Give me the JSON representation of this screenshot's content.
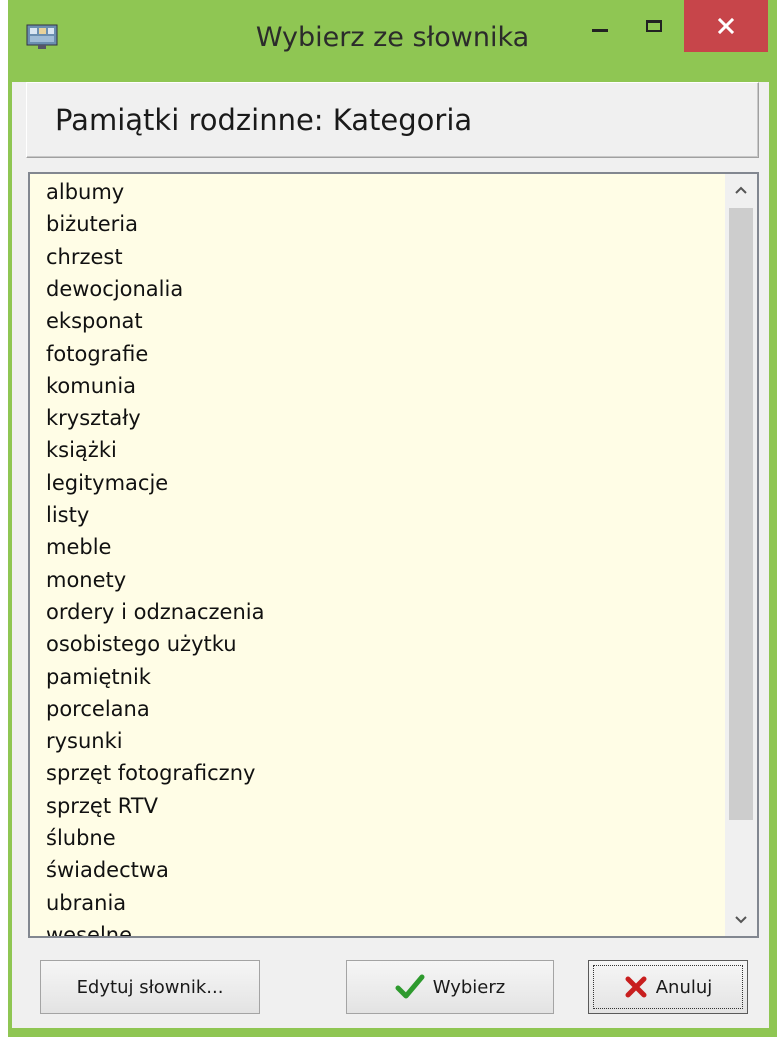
{
  "window": {
    "title": "Wybierz ze słownika"
  },
  "header": {
    "title": "Pamiątki rodzinne: Kategoria"
  },
  "list": {
    "items": [
      "albumy",
      "biżuteria",
      "chrzest",
      "dewocjonalia",
      "eksponat",
      "fotografie",
      "komunia",
      "kryształy",
      "książki",
      "legitymacje",
      "listy",
      "meble",
      "monety",
      "ordery i odznaczenia",
      "osobistego użytku",
      "pamiętnik",
      "porcelana",
      "rysunki",
      "sprzęt fotograficzny",
      "sprzęt RTV",
      "ślubne",
      "świadectwa",
      "ubrania",
      "weselne"
    ]
  },
  "buttons": {
    "edit_label": "Edytuj słownik...",
    "choose_label": "Wybierz",
    "cancel_label": "Anuluj"
  },
  "colors": {
    "window_frame": "#8fc653",
    "close_button": "#c7454a",
    "list_background": "#fffde6",
    "check_icon": "#2e9a2e",
    "cross_icon": "#c81e1e"
  },
  "icons": {
    "app": "app-icon",
    "minimize": "minimize-icon",
    "maximize": "maximize-icon",
    "close": "close-icon",
    "scroll_up": "chevron-up-icon",
    "scroll_down": "chevron-down-icon",
    "choose": "checkmark-icon",
    "cancel": "cross-icon"
  }
}
